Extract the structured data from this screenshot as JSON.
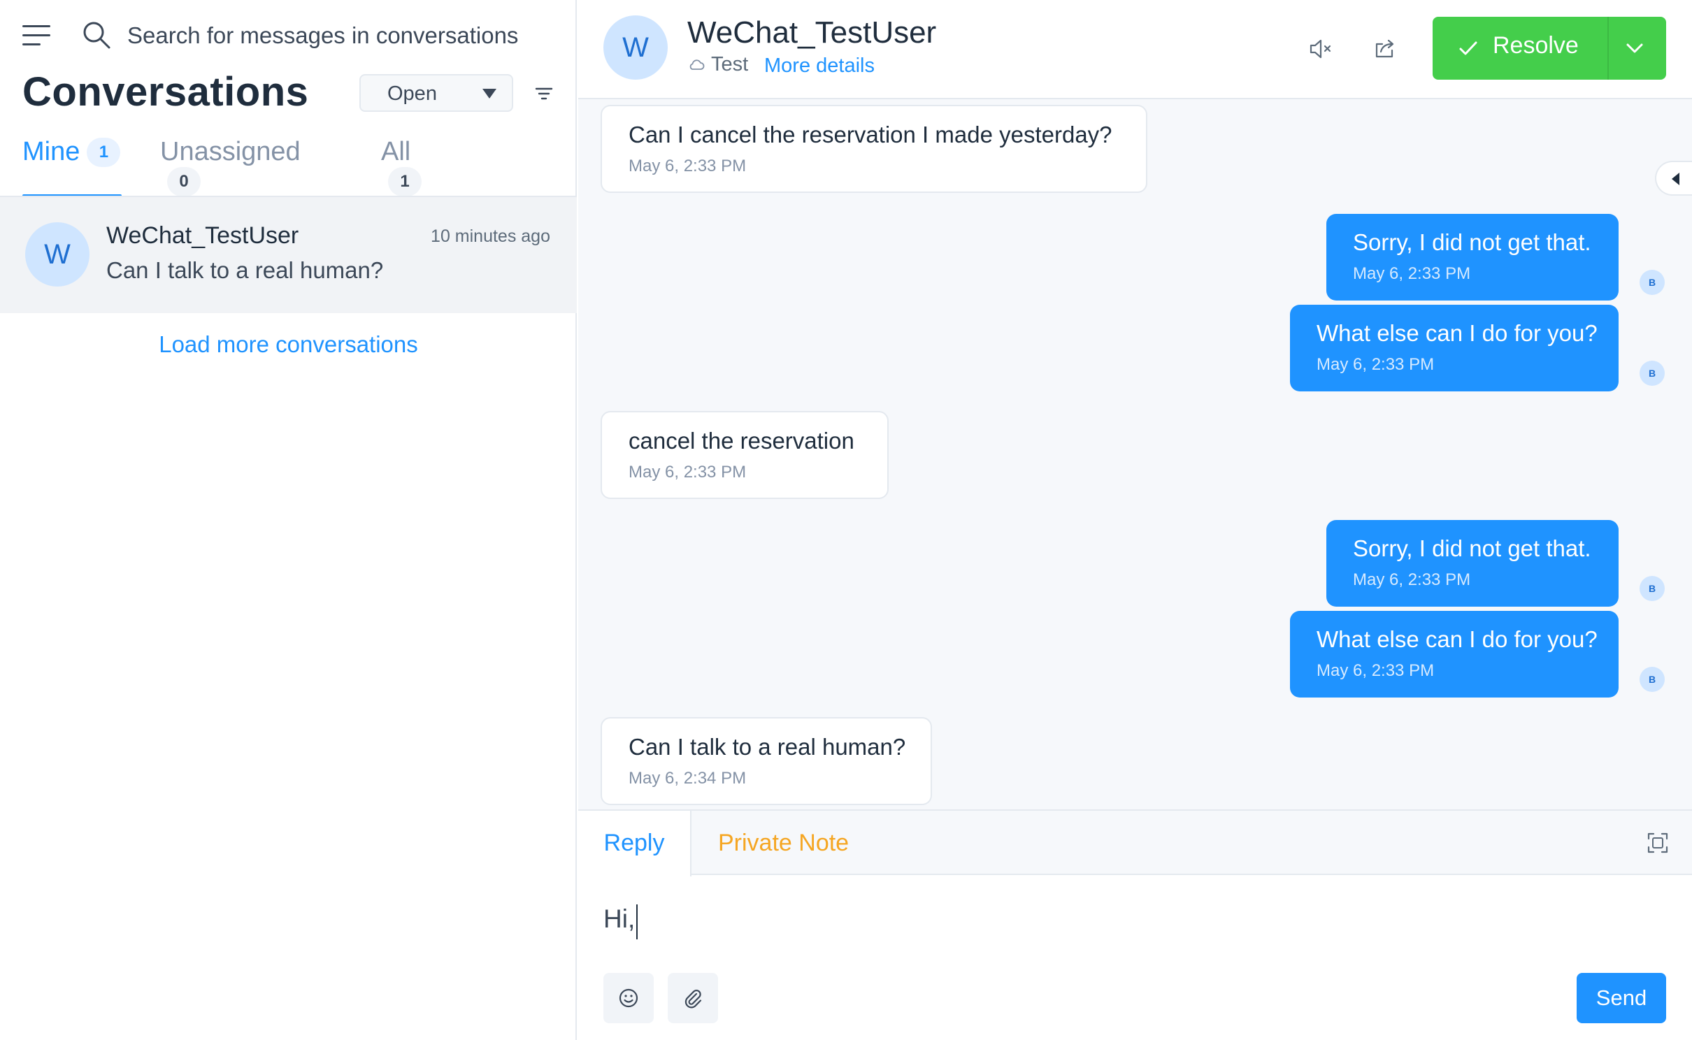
{
  "sidebar": {
    "search_placeholder": "Search for messages in conversations",
    "title": "Conversations",
    "status_filter": "Open",
    "tabs": [
      {
        "label": "Mine",
        "count": "1"
      },
      {
        "label": "Unassigned",
        "count": "0"
      },
      {
        "label": "All",
        "count": "1"
      }
    ],
    "conversation": {
      "avatar": "W",
      "name": "WeChat_TestUser",
      "time": "10 minutes ago",
      "last_message": "Can I talk to a real human?"
    },
    "load_more": "Load more conversations"
  },
  "header": {
    "avatar": "W",
    "name": "WeChat_TestUser",
    "inbox": "Test",
    "more_details": "More details",
    "resolve_label": "Resolve",
    "colors": {
      "resolve": "#44ce4b",
      "accent": "#1f93ff"
    }
  },
  "messages": [
    {
      "dir": "in",
      "text": "Can I cancel the reservation I made yesterday?",
      "time": "May 6, 2:33 PM"
    },
    {
      "dir": "out",
      "text": "Sorry, I did not get that.",
      "time": "May 6, 2:33 PM",
      "avatar": "B"
    },
    {
      "dir": "out",
      "text": "What else can I do for you?",
      "time": "May 6, 2:33 PM",
      "avatar": "B"
    },
    {
      "dir": "in",
      "text": "cancel the reservation",
      "time": "May 6, 2:33 PM"
    },
    {
      "dir": "out",
      "text": "Sorry, I did not get that.",
      "time": "May 6, 2:33 PM",
      "avatar": "B"
    },
    {
      "dir": "out",
      "text": "What else can I do for you?",
      "time": "May 6, 2:33 PM",
      "avatar": "B"
    },
    {
      "dir": "in",
      "text": "Can I talk to a real human?",
      "time": "May 6, 2:34 PM"
    }
  ],
  "reply": {
    "tab_reply": "Reply",
    "tab_note": "Private Note",
    "value": "Hi,",
    "send_label": "Send"
  },
  "icons": [
    "menu-icon",
    "search-icon",
    "filter-icon",
    "cloud-icon",
    "mute-icon",
    "share-icon",
    "check-icon",
    "chevron-down-icon",
    "collapse-icon",
    "expand-icon",
    "emoji-icon",
    "attachment-icon"
  ]
}
